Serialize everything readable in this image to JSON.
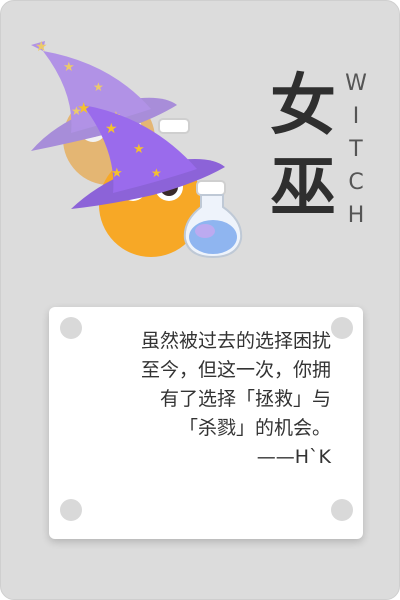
{
  "title": {
    "chinese": [
      "女",
      "巫"
    ],
    "english": [
      "W",
      "I",
      "T",
      "C",
      "H"
    ]
  },
  "quote": {
    "lines": [
      "虽然被过去的选择困扰",
      "至今，但这一次，你拥",
      "有了选择「拯救」与",
      "「杀戮」的机会。"
    ],
    "author": "——H`K"
  },
  "colors": {
    "background": "#dcdcdc",
    "hat": "#9a6bec",
    "face": "#f7a826",
    "star": "#f5c12e",
    "potion": "#8fb5f0"
  },
  "icons": [
    "witch-character-back",
    "witch-character-front",
    "potion-bottle-icon"
  ]
}
